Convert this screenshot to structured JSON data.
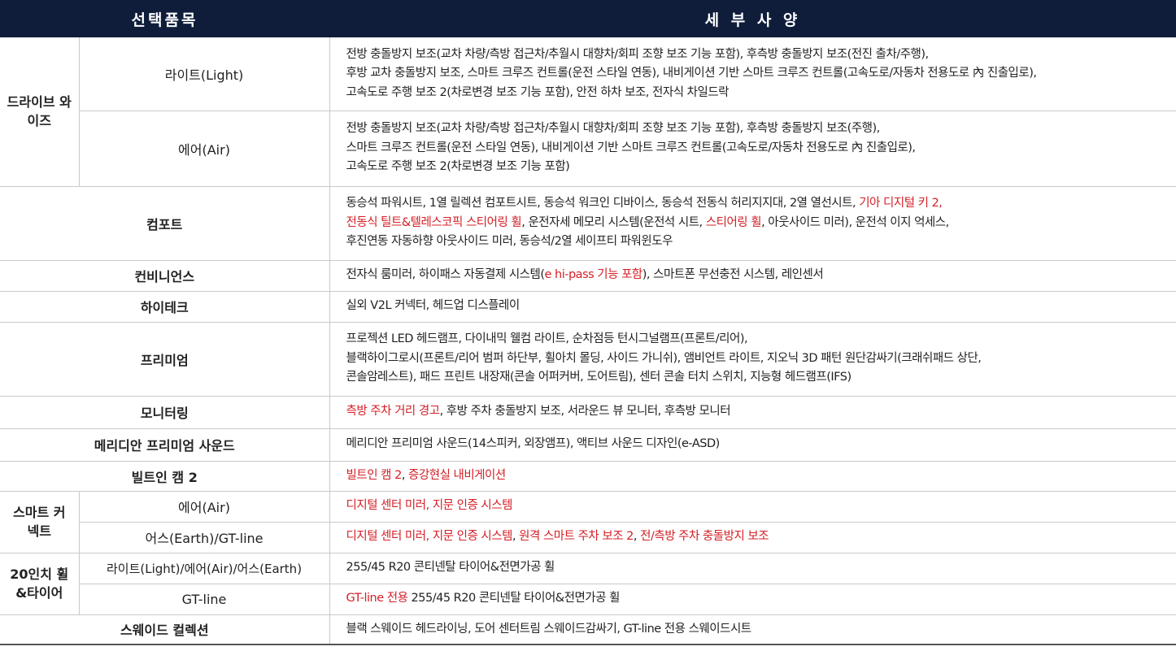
{
  "header": {
    "col1": "선택품목",
    "col2": "세 부 사 양"
  },
  "rows": {
    "drive_wise": {
      "category": "드라이브 와이즈",
      "light": {
        "label": "라이트(Light)",
        "line1": "전방 충돌방지 보조(교차 차량/측방 접근차/추월시 대향차/회피 조향 보조 기능 포함), 후측방 충돌방지 보조(전진 출차/주행),",
        "line2": "후방 교차 충돌방지 보조, 스마트 크루즈 컨트롤(운전 스타일 연동), 내비게이션 기반 스마트 크루즈 컨트롤(고속도로/자동차 전용도로 內 진출입로),",
        "line3": "고속도로 주행 보조 2(차로변경 보조 기능 포함), 안전 하차 보조, 전자식 차일드락"
      },
      "air": {
        "label": "에어(Air)",
        "line1": "전방 충돌방지 보조(교차 차량/측방 접근차/추월시 대향차/회피 조향 보조 기능 포함), 후측방 충돌방지 보조(주행),",
        "line2": "스마트 크루즈 컨트롤(운전 스타일 연동), 내비게이션 기반 스마트 크루즈 컨트롤(고속도로/자동차 전용도로 內 진출입로),",
        "line3": "고속도로 주행 보조 2(차로변경 보조 기능 포함)"
      }
    },
    "comfort": {
      "category": "컴포트",
      "l1a": "동승석 파워시트, 1열 릴렉션 컴포트시트, 동승석 워크인 디바이스, 동승석 전동식 허리지지대, 2열 열선시트, ",
      "l1b": "기아 디지털 키 2,",
      "l2a": "전동식 틸트&텔레스코픽 스티어링 휠",
      "l2b": ", 운전자세 메모리 시스템(운전석 시트, ",
      "l2c": "스티어링 휠",
      "l2d": ", 아웃사이드 미러), 운전석 이지 억세스,",
      "l3": "후진연동 자동하향 아웃사이드 미러, 동승석/2열 세이프티 파워윈도우"
    },
    "convenience": {
      "category": "컨비니언스",
      "a": "전자식 룸미러, 하이패스 자동결제 시스템(",
      "b": "e hi-pass 기능 포함",
      "c": "), 스마트폰 무선충전 시스템, 레인센서"
    },
    "hitech": {
      "category": "하이테크",
      "text": "실외 V2L 커넥터, 헤드업 디스플레이"
    },
    "premium": {
      "category": "프리미엄",
      "line1": "프로젝션 LED 헤드램프, 다이내믹 웰컴 라이트, 순차점등 턴시그널램프(프론트/리어),",
      "line2": "블랙하이그로시(프론트/리어 범퍼 하단부, 휠아치 몰딩, 사이드 가니쉬), 앰비언트 라이트, 지오닉 3D 패턴 원단감싸기(크래쉬패드 상단,",
      "line3": "콘솔암레스트), 패드 프린트 내장재(콘솔 어퍼커버, 도어트림), 센터 콘솔 터치 스위치, 지능형 헤드램프(IFS)"
    },
    "monitoring": {
      "category": "모니터링",
      "a": "측방 주차 거리 경고",
      "b": ", 후방 주차 충돌방지 보조, 서라운드 뷰 모니터, 후측방 모니터"
    },
    "meridian": {
      "category": "메리디안 프리미엄 사운드",
      "text": "메리디안 프리미엄 사운드(14스피커, 외장앰프), 액티브 사운드 디자인(e-ASD)"
    },
    "builtin_cam": {
      "category": "빌트인 캠 2",
      "a": "빌트인 캠 2",
      "b": ", ",
      "c": "증강현실 내비게이션"
    },
    "smart_connect": {
      "category": "스마트 커넥트",
      "air": {
        "label": "에어(Air)",
        "a": "디지털 센터 미러",
        "b": ", ",
        "c": "지문 인증 시스템"
      },
      "earth": {
        "label": "어스(Earth)/GT-line",
        "a": "디지털 센터 미러",
        "b": ", ",
        "c": "지문 인증 시스템",
        "d": ", ",
        "e": "원격 스마트 주차 보조 2",
        "f": ", ",
        "g": "전/측방 주차 충돌방지 보조"
      }
    },
    "wheel": {
      "category": "20인치 휠 &타이어",
      "r1": {
        "label": "라이트(Light)/에어(Air)/어스(Earth)",
        "text": "255/45 R20 콘티넨탈 타이어&전면가공 휠"
      },
      "r2": {
        "label": "GT-line",
        "a": "GT-line 전용",
        "b": " 255/45 R20 콘티넨탈 타이어&전면가공 휠"
      }
    },
    "suede": {
      "category": "스웨이드 컬렉션",
      "text": "블랙 스웨이드 헤드라이닝, 도어 센터트림 스웨이드감싸기, GT-line 전용 스웨이드시트"
    }
  },
  "colors": {
    "header_bg": "#0f1d3b",
    "highlight": "#d42027",
    "border": "#c9c9c9"
  }
}
